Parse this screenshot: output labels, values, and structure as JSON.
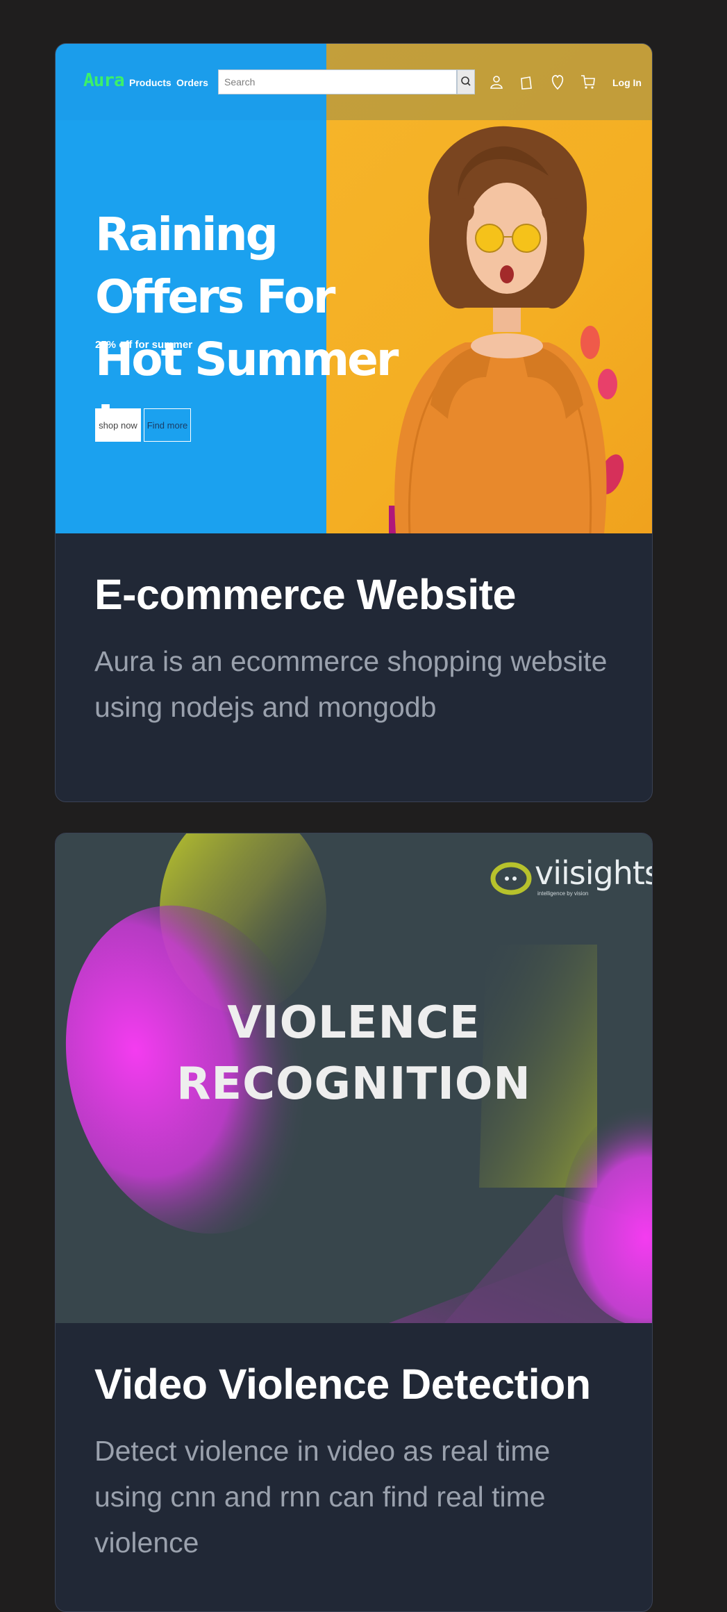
{
  "projects": [
    {
      "title": "E-commerce Website",
      "description": "Aura is an ecommerce shopping website using nodejs and mongodb",
      "preview": {
        "brand": "Aura",
        "nav_links": [
          "Products",
          "Orders"
        ],
        "search_placeholder": "Search",
        "login_label": "Log In",
        "hero_title": "Raining Offers For Hot Summer !",
        "hero_subtitle": "25% off for summer",
        "primary_button": "shop now",
        "secondary_button": "Find more",
        "icons": [
          "search-icon",
          "user-icon",
          "bag-icon",
          "heart-icon",
          "cart-icon"
        ],
        "colors": {
          "blue": "#1ba1ef",
          "yellow": "#f4ae23",
          "brand_green": "#3cf06a"
        }
      }
    },
    {
      "title": "Video Violence Detection",
      "description": "Detect violence in video as real time using cnn and rnn can find real time violence",
      "preview": {
        "headline_line1": "VIOLENCE",
        "headline_line2": "RECOGNITION",
        "logo_text": "viisights",
        "logo_tagline": "intelligence by vision",
        "colors": {
          "background": "#38464c",
          "magenta": "#f43cf0",
          "olive": "#b7c22c"
        }
      }
    }
  ]
}
